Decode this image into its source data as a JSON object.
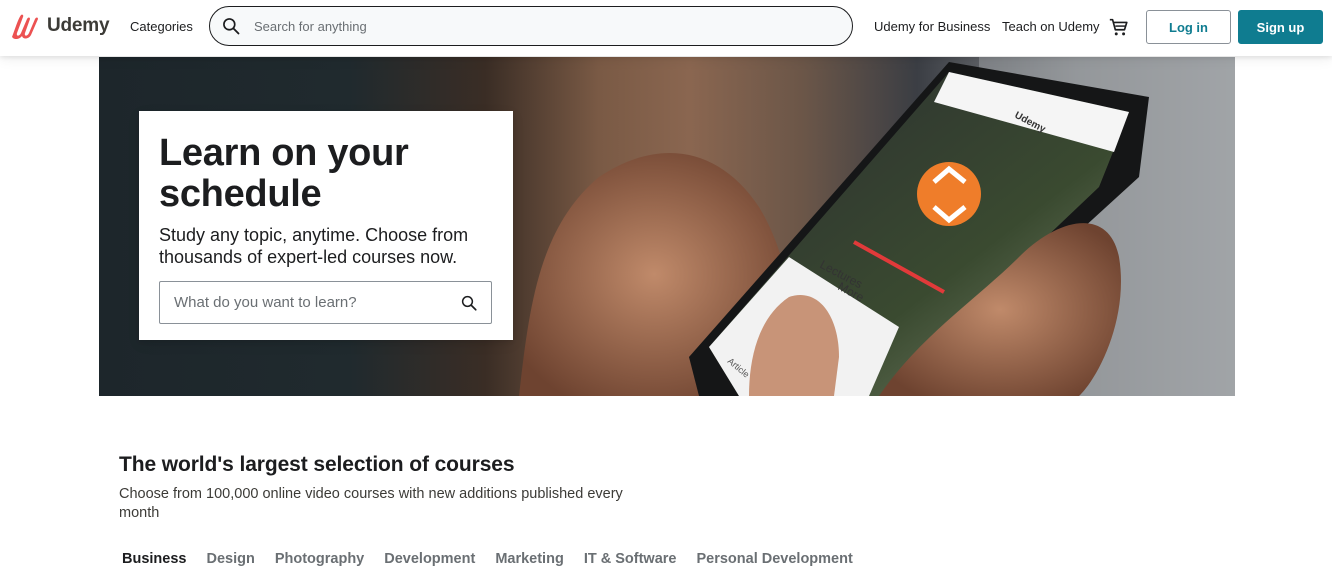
{
  "header": {
    "logo_text": "Udemy",
    "categories_label": "Categories",
    "search_placeholder": "Search for anything",
    "nav_links": [
      "Udemy for Business",
      "Teach on Udemy"
    ],
    "login_label": "Log in",
    "signup_label": "Sign up",
    "colors": {
      "brand": "#ec5252",
      "accent": "#0f7c90"
    }
  },
  "hero": {
    "title": "Learn on your schedule",
    "subtitle": "Study any topic, anytime. Choose from thousands of expert-led courses now.",
    "search_placeholder": "What do you want to learn?",
    "phone_app_labels": [
      "Udemy",
      "Lectures",
      "More",
      "Article"
    ]
  },
  "courses": {
    "title": "The world's largest selection of courses",
    "subtitle": "Choose from 100,000 online video courses with new additions published every month",
    "tabs": [
      {
        "label": "Business",
        "active": true
      },
      {
        "label": "Design",
        "active": false
      },
      {
        "label": "Photography",
        "active": false
      },
      {
        "label": "Development",
        "active": false
      },
      {
        "label": "Marketing",
        "active": false
      },
      {
        "label": "IT & Software",
        "active": false
      },
      {
        "label": "Personal Development",
        "active": false
      }
    ]
  }
}
